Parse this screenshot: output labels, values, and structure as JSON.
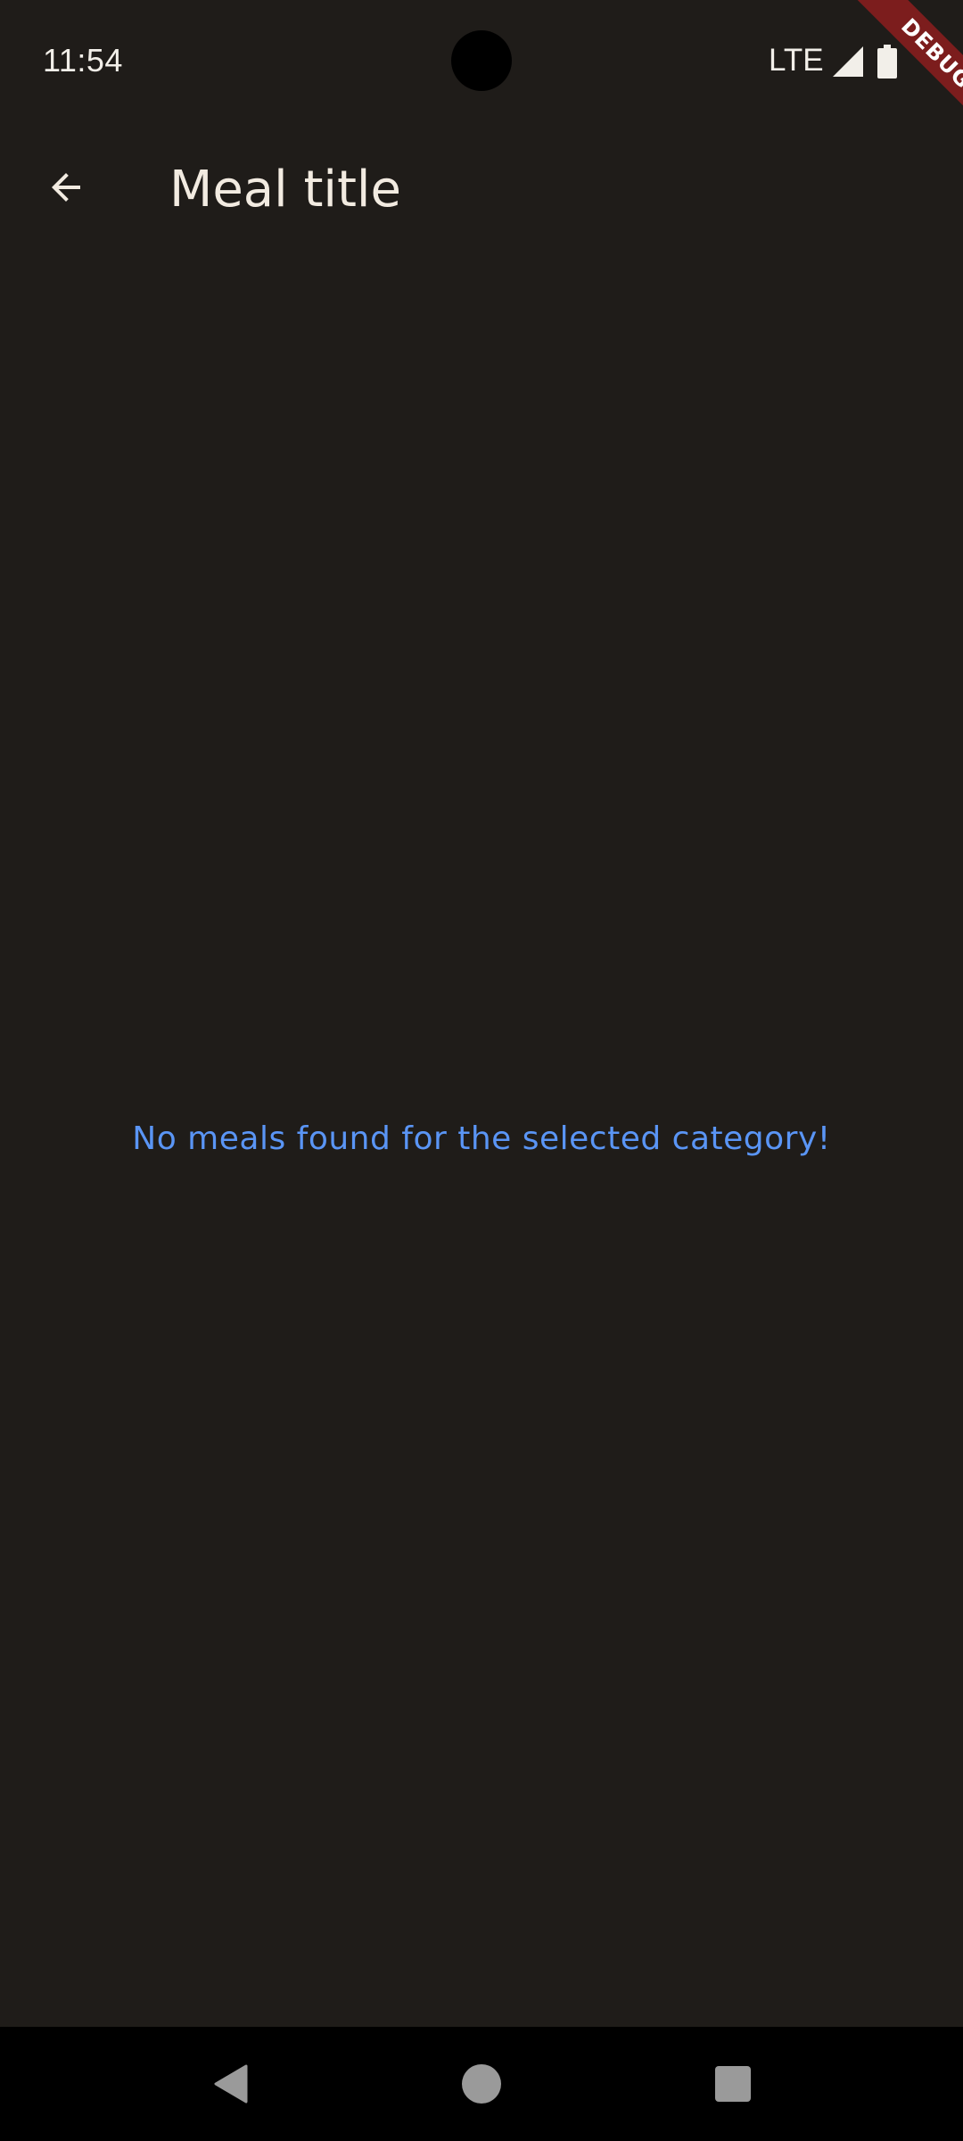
{
  "status_bar": {
    "time": "11:54",
    "network": "LTE",
    "icons": [
      "signal-icon",
      "battery-icon"
    ]
  },
  "debug_banner": {
    "label": "DEBUG",
    "color": "#7c1d1d"
  },
  "app_bar": {
    "back_icon": "arrow-back-icon",
    "title": "Meal title"
  },
  "content": {
    "empty_message": "No meals found for the selected category!",
    "message_color": "#5a95f5"
  },
  "nav_bar": {
    "icons": [
      "nav-back-icon",
      "nav-home-icon",
      "nav-recents-icon"
    ]
  },
  "colors": {
    "background": "#1f1c19",
    "on_surface": "#f2ebe1"
  }
}
